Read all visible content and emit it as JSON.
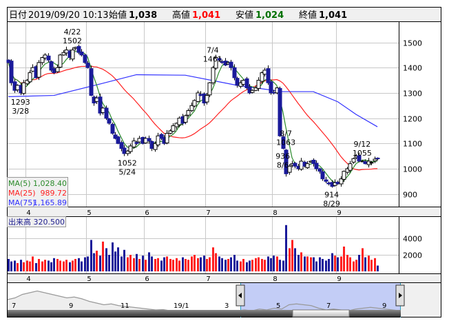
{
  "header": {
    "date_label": "日付",
    "date_value": "2019/09/20 10:13",
    "open_label": "始値",
    "open_value": "1,038",
    "high_label": "高値",
    "high_value": "1,041",
    "low_label": "安値",
    "low_value": "1,024",
    "close_label": "終値",
    "close_value": "1,041"
  },
  "legend": {
    "ma5_label": "MA(5)",
    "ma5_value": "1,028.40",
    "ma25_label": "MA(25)",
    "ma25_value": "989.72",
    "ma75_label": "MA(75)",
    "ma75_value": "1,165.89"
  },
  "volume_legend": {
    "label": "出来高",
    "value": "320.500"
  },
  "colors": {
    "up_volume": "#ff2020",
    "down": "#1a1a9a",
    "ma5": "#2a8a2a",
    "ma25": "#ff2020",
    "ma75": "#3030ff",
    "grid": "#c8c8c8",
    "nav_fill": "#b8c4f4"
  },
  "chart_data": {
    "type": "candlestick",
    "title": "",
    "ylim": [
      870,
      1560
    ],
    "price_ticks": [
      "900",
      "1000",
      "1100",
      "1200",
      "1300",
      "1400",
      "1500"
    ],
    "volume_ticks": [
      "2000",
      "4000"
    ],
    "months": [
      {
        "label": "4",
        "start_index": 6
      },
      {
        "label": "5",
        "start_index": 26
      },
      {
        "label": "6",
        "start_index": 45
      },
      {
        "label": "7",
        "start_index": 65
      },
      {
        "label": "8",
        "start_index": 87
      },
      {
        "label": "9",
        "start_index": 108
      }
    ],
    "closes": [
      1420,
      1340,
      1310,
      1330,
      1300,
      1340,
      1350,
      1380,
      1400,
      1360,
      1420,
      1440,
      1450,
      1430,
      1390,
      1380,
      1400,
      1450,
      1460,
      1470,
      1440,
      1470,
      1480,
      1460,
      1450,
      1420,
      1400,
      1290,
      1260,
      1280,
      1220,
      1240,
      1200,
      1180,
      1140,
      1120,
      1100,
      1080,
      1060,
      1070,
      1090,
      1110,
      1100,
      1120,
      1100,
      1120,
      1110,
      1080,
      1100,
      1130,
      1120,
      1100,
      1140,
      1150,
      1170,
      1180,
      1200,
      1180,
      1210,
      1230,
      1250,
      1270,
      1300,
      1290,
      1260,
      1290,
      1340,
      1400,
      1440,
      1430,
      1420,
      1410,
      1420,
      1400,
      1360,
      1330,
      1340,
      1350,
      1320,
      1300,
      1310,
      1320,
      1350,
      1380,
      1390,
      1340,
      1300,
      1300,
      1320,
      1130,
      1080,
      980,
      1010,
      1020,
      1010,
      1000,
      1030,
      1010,
      1020,
      1030,
      1020,
      1000,
      990,
      960,
      950,
      940,
      930,
      945,
      940,
      960,
      990,
      1000,
      1020,
      1040,
      1050,
      1030,
      1030,
      1020,
      1030,
      1025,
      1038,
      1041
    ],
    "volumes": [
      1500,
      1200,
      1300,
      1000,
      1400,
      1100,
      1300,
      1200,
      1800,
      1000,
      1500,
      1200,
      1400,
      1300,
      1100,
      1600,
      1500,
      1300,
      1200,
      1400,
      1100,
      1300,
      1500,
      1600,
      1200,
      1700,
      1800,
      3800,
      2200,
      2500,
      1900,
      3600,
      2800,
      2000,
      3500,
      2400,
      2900,
      1800,
      2600,
      1700,
      2000,
      1600,
      2100,
      1500,
      1900,
      1400,
      2300,
      1800,
      1500,
      1600,
      1300,
      1700,
      1800,
      1500,
      1400,
      1600,
      1300,
      1700,
      1500,
      1400,
      1800,
      2000,
      1600,
      1700,
      1900,
      1500,
      1700,
      2900,
      2200,
      1800,
      1600,
      1400,
      1500,
      1700,
      2000,
      1300,
      1200,
      1500,
      1100,
      1300,
      1400,
      1600,
      1700,
      1500,
      1400,
      1800,
      1600,
      1900,
      1800,
      1400,
      1300,
      5600,
      2800,
      3800,
      2800,
      2000,
      2300,
      1800,
      1800,
      1700,
      1700,
      1200,
      1700,
      1500,
      1300,
      1500,
      2200,
      1900,
      1700,
      1800,
      3000,
      2000,
      1700,
      1200,
      1400,
      2000,
      2800,
      1700,
      1900,
      1400,
      1600,
      700
    ],
    "ma75_keypoints": [
      [
        0,
        1285
      ],
      [
        15,
        1290
      ],
      [
        30,
        1335
      ],
      [
        42,
        1372
      ],
      [
        58,
        1370
      ],
      [
        75,
        1330
      ],
      [
        90,
        1305
      ],
      [
        100,
        1305
      ],
      [
        108,
        1265
      ],
      [
        114,
        1215
      ],
      [
        121,
        1166
      ]
    ],
    "annotations": [
      {
        "date": "3/28",
        "value": "1293",
        "index": 4,
        "pos": "below"
      },
      {
        "date": "4/22",
        "value": "1502",
        "index": 21,
        "pos": "above"
      },
      {
        "date": "5/24",
        "value": "1052",
        "index": 39,
        "pos": "below"
      },
      {
        "date": "7/4",
        "value": "1461",
        "index": 67,
        "pos": "above"
      },
      {
        "date": "8/6",
        "value": "936",
        "index": 90,
        "pos": "below"
      },
      {
        "date": "8/7",
        "value": "1063",
        "index": 91,
        "pos": "above"
      },
      {
        "date": "8/29",
        "value": "914",
        "index": 106,
        "pos": "below"
      },
      {
        "date": "9/12",
        "value": "1055",
        "index": 116,
        "pos": "above"
      }
    ]
  },
  "navigator": {
    "labels": [
      "7",
      "9",
      "11",
      "19/1",
      "3",
      "5",
      "7",
      "9"
    ],
    "history": [
      1390,
      1400,
      1420,
      1430,
      1440,
      1430,
      1420,
      1410,
      1400,
      1405,
      1395,
      1380,
      1370,
      1360,
      1365,
      1355,
      1350,
      1345,
      1340,
      1335,
      1330,
      1332,
      1325,
      1320,
      1310,
      1300,
      1305,
      1310,
      1300,
      1320,
      1315,
      1325,
      1330,
      1325,
      1335,
      1330,
      1340,
      1335,
      1360,
      1365,
      1360,
      1355,
      1340,
      1330,
      1335,
      1330,
      1325,
      1335,
      1340,
      1345,
      1340,
      1335,
      1330,
      1325
    ]
  }
}
